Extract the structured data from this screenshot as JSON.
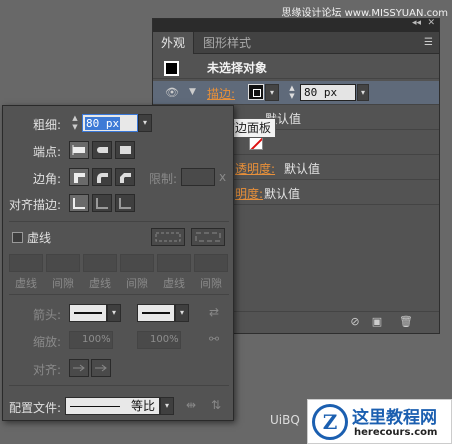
{
  "watermark_top": "思缘设计论坛 www.MISSYUAN.com",
  "appearance": {
    "tabs": [
      "外观",
      "图形样式"
    ],
    "object_title": "未选择对象",
    "stroke_label": "描边:",
    "stroke_value": "80 px",
    "fill_partial": "透明度",
    "fill_default": "默认值",
    "opacity_partial": "透明度:",
    "opacity_default": "默认值",
    "opacity2_partial": "明度:",
    "opacity2_default": "默认值",
    "row2_partial": "透明度",
    "row2_default": "默认值"
  },
  "tooltip": "描边面板",
  "stroke_panel": {
    "weight_label": "粗细:",
    "weight_value": "80 px",
    "cap_label": "端点:",
    "corner_label": "边角:",
    "limit_label": "限制:",
    "limit_suffix": "x",
    "align_label": "对齐描边:",
    "dashed_label": "虚线",
    "dash_labels": [
      "虚线",
      "间隙",
      "虚线",
      "间隙",
      "虚线",
      "间隙"
    ],
    "arrow_label": "箭头:",
    "scale_label": "缩放:",
    "scale_values": [
      "100%",
      "100%"
    ],
    "align2_label": "对齐:",
    "profile_label": "配置文件:",
    "profile_value": "等比"
  },
  "badge": {
    "title": "这里教程网",
    "url": "herecours.com"
  },
  "ps_mark": "UiBQ"
}
